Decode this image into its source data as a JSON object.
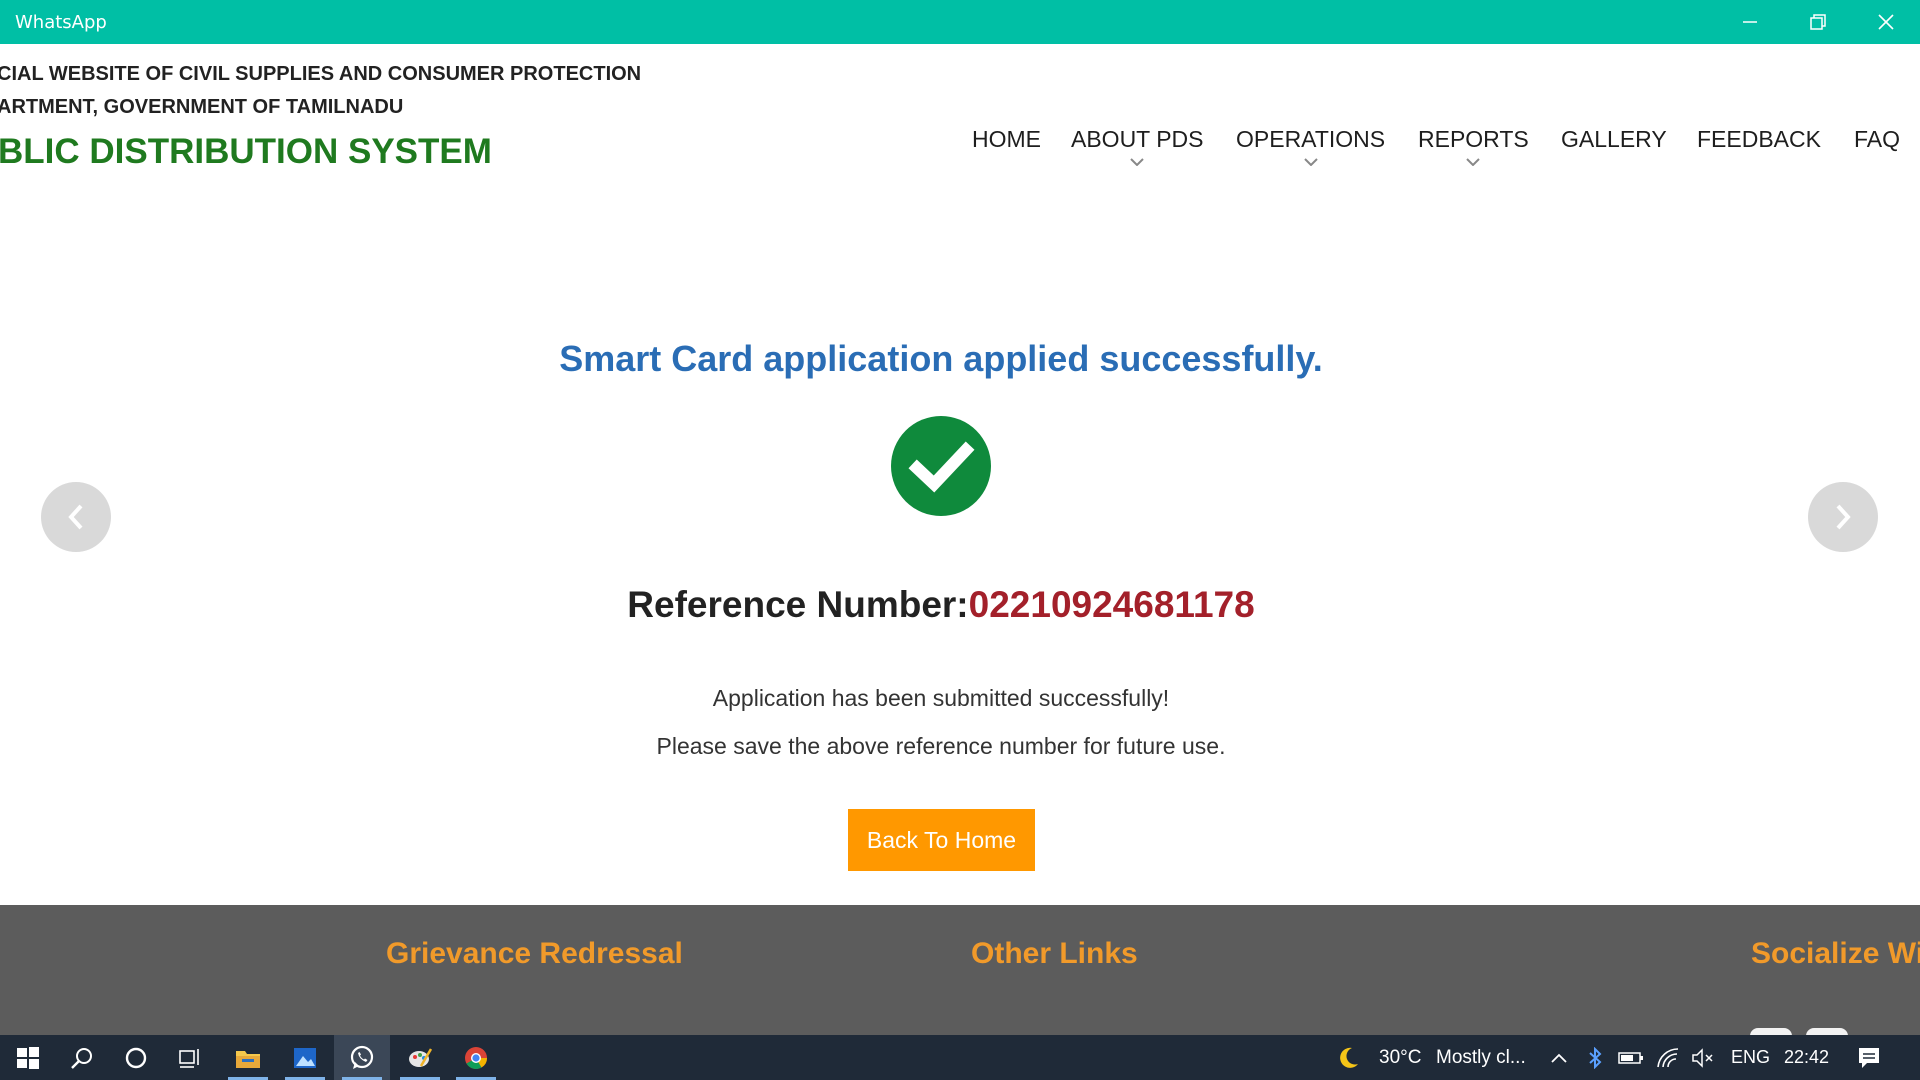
{
  "window": {
    "title": "WhatsApp",
    "minimize_icon": "minimize-icon",
    "restore_icon": "restore-icon",
    "close_icon": "close-icon"
  },
  "header": {
    "dept_line1": "CIAL WEBSITE OF CIVIL SUPPLIES AND CONSUMER PROTECTION",
    "dept_line2": "ARTMENT, GOVERNMENT OF TAMILNADU",
    "system_name": "BLIC DISTRIBUTION SYSTEM",
    "nav": [
      "HOME",
      "ABOUT PDS",
      "OPERATIONS",
      "REPORTS",
      "GALLERY",
      "FEEDBACK",
      "FAQ"
    ]
  },
  "main": {
    "success_title": "Smart Card application applied successfully.",
    "reference_label": "Reference Number:",
    "reference_number": "02210924681178",
    "message_line1": "Application has been submitted successfully!",
    "message_line2": "Please save the above reference number for future use.",
    "back_button": "Back To Home"
  },
  "footer": {
    "grievance": "Grievance Redressal",
    "other_links": "Other Links",
    "socialize": "Socialize Wi"
  },
  "taskbar": {
    "weather_temp": "30°C",
    "weather_desc": "Mostly cl...",
    "language": "ENG",
    "time": "22:42"
  },
  "colors": {
    "titlebar": "#00bfa5",
    "success_title": "#2a6db5",
    "check_green": "#0f8a3c",
    "reference_number": "#a3202a",
    "button": "#ff9800",
    "footer_bg": "#5c5c5c",
    "footer_heading": "#f19a2a",
    "taskbar_bg": "#1f2a38",
    "pds_green": "#1f7a1f"
  }
}
